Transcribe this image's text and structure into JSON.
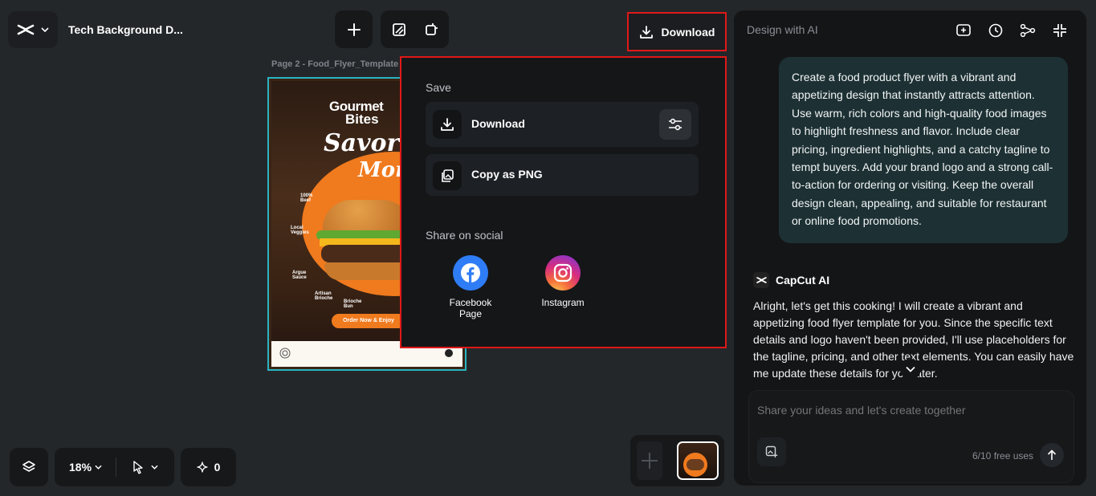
{
  "header": {
    "doc_title": "Tech Background D...",
    "download_label": "Download"
  },
  "canvas": {
    "page_label": "Page 2 -  Food_Flyer_Template",
    "flyer": {
      "brand_line1": "Gourmet",
      "brand_line2": "Bites",
      "tagline_line1": "Savor th",
      "tagline_line2": "Momen",
      "feature1": "100% Beef",
      "feature2": "Local Veggies",
      "feature3": "Argue Sauce",
      "feature4": "Artisan Brioche",
      "feature5": "Brioche Bun",
      "cta": "Order Now & Enjoy"
    }
  },
  "dropdown": {
    "save_label": "Save",
    "download_label": "Download",
    "copy_label": "Copy as PNG",
    "share_label": "Share on social",
    "facebook_label": "Facebook Page",
    "instagram_label": "Instagram"
  },
  "right_panel": {
    "title": "Design with AI",
    "user_message": "Create a food product flyer with a vibrant and appetizing design that instantly attracts attention. Use warm, rich colors and high-quality food images to highlight freshness and flavor. Include clear pricing, ingredient highlights, and a catchy tagline to tempt buyers. Add your brand logo and a strong call-to-action for ordering or visiting. Keep the overall design clean, appealing, and suitable for restaurant or online food promotions.",
    "ai_name": "CapCut AI",
    "ai_message": "Alright, let's get this cooking! I will create a vibrant and appetizing food flyer template for you. Since the specific text details and logo haven't been provided, I'll use placeholders for the tagline, pricing, and other text elements. You can easily have me update these details for you later.",
    "input_placeholder": "Share your ideas and let's create together",
    "uses_label": "6/10 free uses"
  },
  "bottom": {
    "zoom": "18%",
    "ai_count": "0"
  },
  "colors": {
    "highlight_border": "#e01818",
    "selection_border": "#2ab4c2",
    "user_bubble": "#1d3134",
    "flyer_orange": "#f07a1e"
  }
}
